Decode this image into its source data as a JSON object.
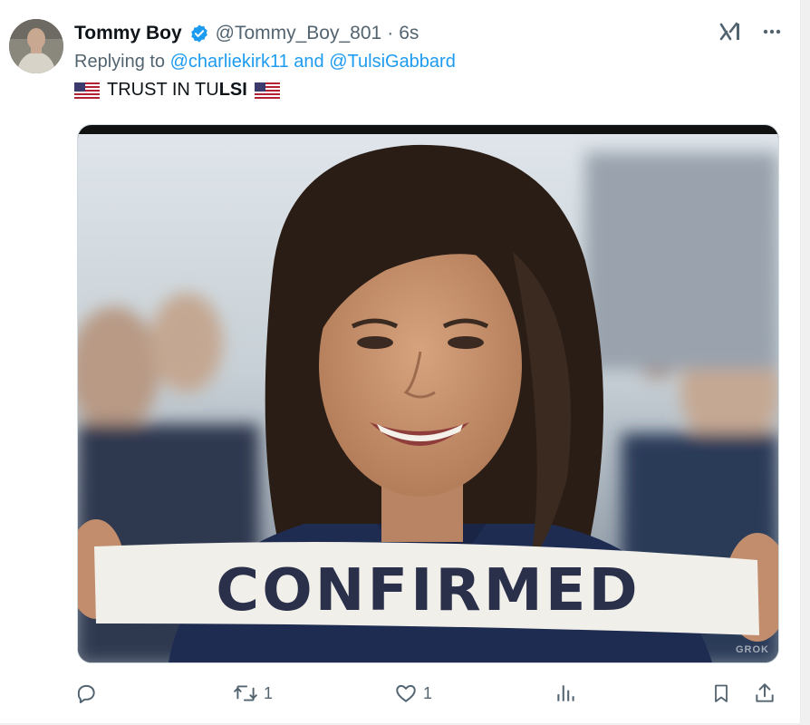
{
  "tweet": {
    "display_name": "Tommy Boy",
    "handle": "@Tommy_Boy_801",
    "separator": "·",
    "timestamp": "6s",
    "replying_prefix": "Replying to",
    "replying_mention_1": "@charliekirk11",
    "replying_and": "and",
    "replying_mention_2": "@TulsiGabbard",
    "text_part_1": "TRUST IN TU",
    "text_part_2": "LSI"
  },
  "media": {
    "banner_text": "CONFIRMED",
    "watermark": "GROK"
  },
  "actions": {
    "reply_count": "",
    "retweet_count": "1",
    "like_count": "1",
    "views_count": ""
  },
  "icons": {
    "verified": "verified-badge-icon",
    "grok": "grok-icon",
    "more": "more-icon",
    "reply": "reply-icon",
    "retweet": "retweet-icon",
    "like": "like-icon",
    "views": "views-icon",
    "bookmark": "bookmark-icon",
    "share": "share-icon",
    "flag": "us-flag-icon"
  },
  "colors": {
    "link": "#1d9bf0",
    "secondary_text": "#536471",
    "primary_text": "#0f1419"
  }
}
